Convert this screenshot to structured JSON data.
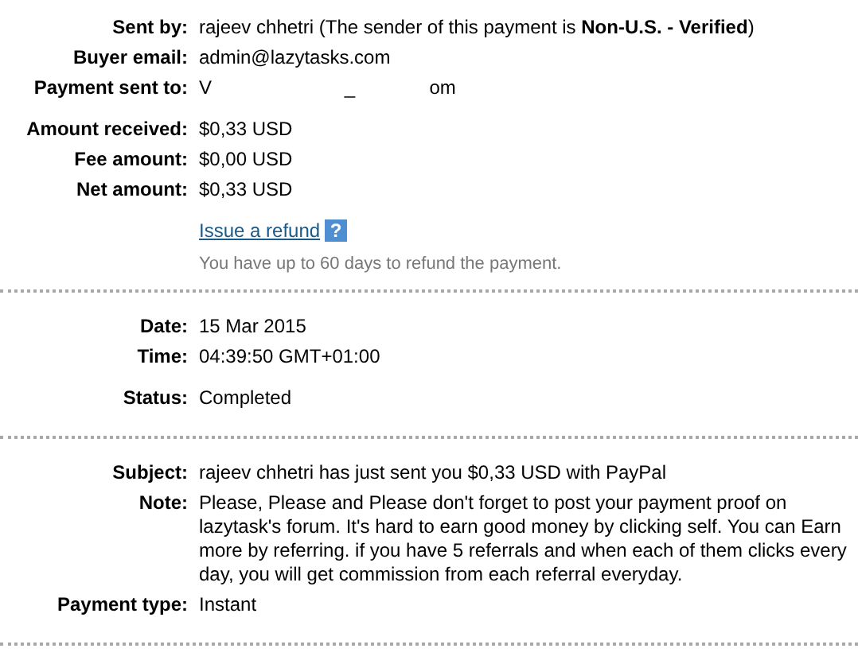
{
  "sections": [
    {
      "groups": [
        {
          "rows": [
            {
              "label": "Sent by:",
              "value": "rajeev chhetri (The sender of this payment is **Non-U.S. - Verified**)"
            },
            {
              "label": "Buyer email:",
              "value": "admin@lazytasks.com"
            },
            {
              "label": "Payment sent to:",
              "value": "V                         _              om"
            }
          ]
        },
        {
          "rows": [
            {
              "label": "Amount received:",
              "value": "$0,33 USD"
            },
            {
              "label": "Fee amount:",
              "value": "$0,00 USD"
            },
            {
              "label": "Net amount:",
              "value": "$0,33 USD"
            }
          ]
        }
      ],
      "refund": {
        "link": "Issue a refund",
        "help": "?",
        "hint": "You have up to 60 days to refund the payment."
      }
    },
    {
      "groups": [
        {
          "rows": [
            {
              "label": "Date:",
              "value": "15 Mar 2015"
            },
            {
              "label": "Time:",
              "value": "04:39:50 GMT+01:00"
            }
          ]
        },
        {
          "rows": [
            {
              "label": "Status:",
              "value": "Completed"
            }
          ]
        }
      ]
    },
    {
      "groups": [
        {
          "rows": [
            {
              "label": "Subject:",
              "value": "rajeev chhetri has just sent you $0,33 USD with PayPal"
            },
            {
              "label": "Note:",
              "value": "Please, Please and Please don't forget to post your payment proof on lazytask's forum. It's hard to earn good money by clicking self. You can Earn more by referring. if you have 5 referrals and when each of them clicks every day, you will get commission from each referral everyday."
            },
            {
              "label": "Payment type:",
              "value": "Instant"
            }
          ]
        }
      ]
    }
  ]
}
